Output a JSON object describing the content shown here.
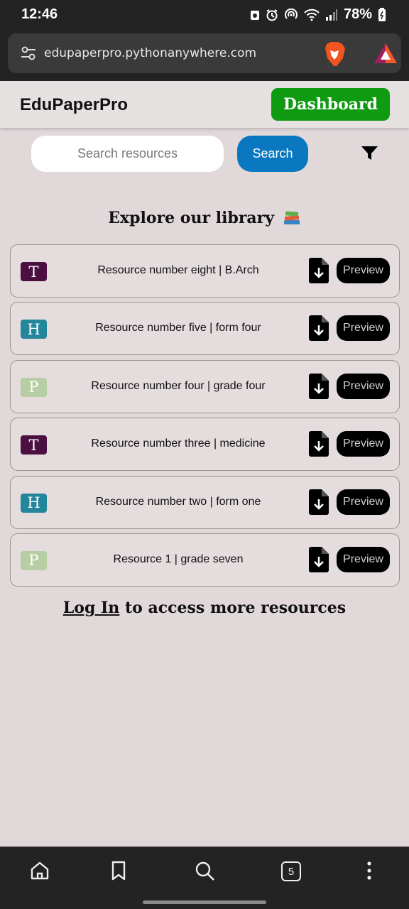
{
  "status_bar": {
    "time": "12:46",
    "battery": "78%"
  },
  "browser": {
    "url": "edupaperpro.pythonanywhere.com",
    "tab_count": "5"
  },
  "header": {
    "brand": "EduPaperPro",
    "dashboard_label": "Dashboard"
  },
  "search": {
    "placeholder": "Search resources",
    "button_label": "Search"
  },
  "library": {
    "title": "Explore our library"
  },
  "resources": [
    {
      "badge": "T",
      "badge_color": "#4b1040",
      "title": "Resource number eight | B.Arch",
      "preview_label": "Preview"
    },
    {
      "badge": "H",
      "badge_color": "#23869b",
      "title": "Resource number five | form four",
      "preview_label": "Preview"
    },
    {
      "badge": "P",
      "badge_color": "#b7cda3",
      "title": "Resource number four | grade four",
      "preview_label": "Preview"
    },
    {
      "badge": "T",
      "badge_color": "#4b1040",
      "title": "Resource number three | medicine",
      "preview_label": "Preview"
    },
    {
      "badge": "H",
      "badge_color": "#23869b",
      "title": "Resource number two | form one",
      "preview_label": "Preview"
    },
    {
      "badge": "P",
      "badge_color": "#b7cda3",
      "title": "Resource 1 | grade seven",
      "preview_label": "Preview"
    }
  ],
  "footer_prompt": {
    "link_label": "Log In",
    "text": " to access more resources"
  },
  "colors": {
    "dashboard_green": "#0f9b11",
    "search_blue": "#0a78c0",
    "page_bg": "#e0d8d9"
  }
}
